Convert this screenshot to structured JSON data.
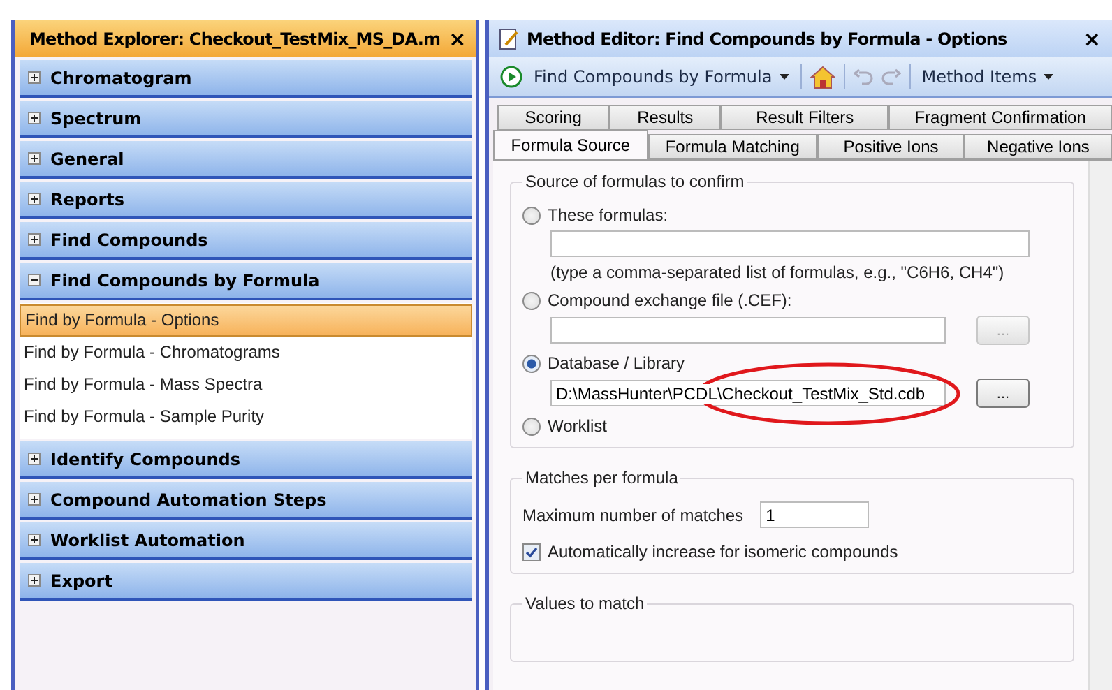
{
  "explorer": {
    "title": "Method Explorer: Checkout_TestMix_MS_DA.m",
    "close": "×",
    "groups": [
      {
        "label": "Chromatogram",
        "expanded": false
      },
      {
        "label": "Spectrum",
        "expanded": false
      },
      {
        "label": "General",
        "expanded": false
      },
      {
        "label": "Reports",
        "expanded": false
      },
      {
        "label": "Find Compounds",
        "expanded": false
      },
      {
        "label": "Find Compounds by Formula",
        "expanded": true,
        "items": [
          {
            "label": "Find by Formula - Options",
            "selected": true
          },
          {
            "label": "Find by Formula - Chromatograms",
            "selected": false
          },
          {
            "label": "Find by Formula - Mass Spectra",
            "selected": false
          },
          {
            "label": "Find by Formula - Sample Purity",
            "selected": false
          }
        ]
      },
      {
        "label": "Identify Compounds",
        "expanded": false
      },
      {
        "label": "Compound Automation Steps",
        "expanded": false
      },
      {
        "label": "Worklist Automation",
        "expanded": false
      },
      {
        "label": "Export",
        "expanded": false
      }
    ]
  },
  "editor": {
    "title": "Method Editor: Find Compounds by Formula - Options",
    "close": "×",
    "toolbar": {
      "step": "Find Compounds by Formula",
      "method_items": "Method Items"
    },
    "tab_rows": [
      [
        {
          "label": "Scoring",
          "selected": false
        },
        {
          "label": "Results",
          "selected": false
        },
        {
          "label": "Result Filters",
          "selected": false
        },
        {
          "label": "Fragment Confirmation",
          "selected": false
        }
      ],
      [
        {
          "label": "Formula Source",
          "selected": true
        },
        {
          "label": "Formula Matching",
          "selected": false
        },
        {
          "label": "Positive Ions",
          "selected": false
        },
        {
          "label": "Negative Ions",
          "selected": false
        }
      ]
    ],
    "source": {
      "legend": "Source of formulas to confirm",
      "options": [
        {
          "kind": "text",
          "label": "These formulas:",
          "selected": false,
          "hint": "(type a comma-separated list of formulas, e.g., \"C6H6, CH4\")"
        },
        {
          "kind": "file",
          "label": "Compound exchange file (.CEF):",
          "selected": false,
          "browse": "...",
          "browse_disabled": true
        },
        {
          "kind": "file",
          "label": "Database / Library",
          "selected": true,
          "value": "D:\\MassHunter\\PCDL\\Checkout_TestMix_Std.cdb",
          "browse": "...",
          "browse_disabled": false
        },
        {
          "kind": "plain",
          "label": "Worklist",
          "selected": false
        }
      ]
    },
    "matches": {
      "legend": "Matches per formula",
      "max_label": "Maximum number of matches",
      "max_value": "1",
      "auto_label": "Automatically increase for isomeric compounds",
      "auto_checked": true
    },
    "values": {
      "legend": "Values to match"
    }
  }
}
